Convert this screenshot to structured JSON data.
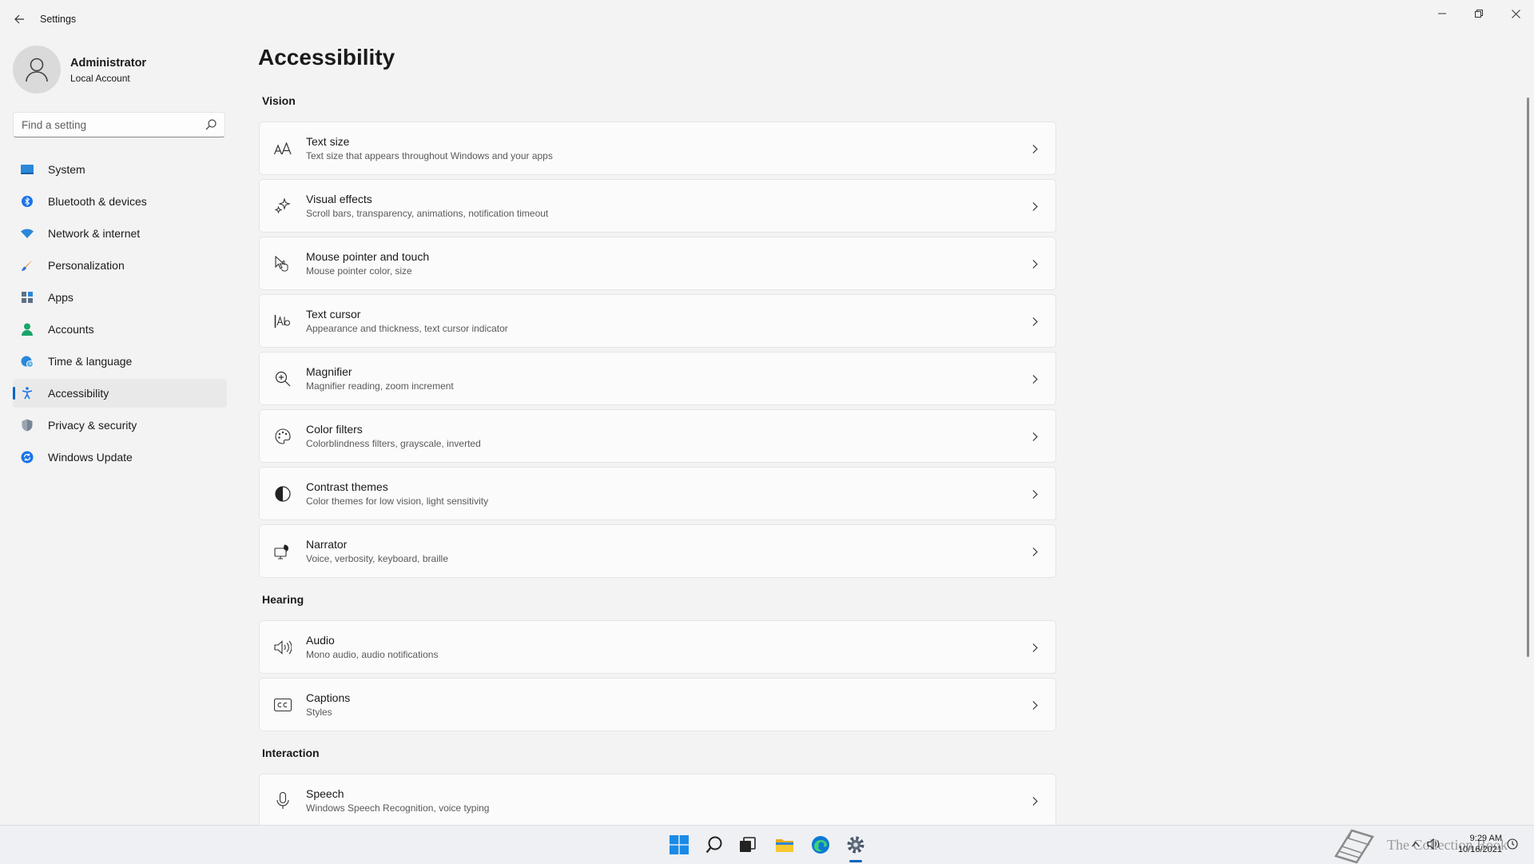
{
  "window": {
    "title": "Settings"
  },
  "profile": {
    "name": "Administrator",
    "account_type": "Local Account"
  },
  "search": {
    "placeholder": "Find a setting"
  },
  "sidebar": {
    "items": [
      {
        "label": "System",
        "icon": "system-icon"
      },
      {
        "label": "Bluetooth & devices",
        "icon": "bluetooth-icon"
      },
      {
        "label": "Network & internet",
        "icon": "wifi-icon"
      },
      {
        "label": "Personalization",
        "icon": "brush-icon"
      },
      {
        "label": "Apps",
        "icon": "apps-icon"
      },
      {
        "label": "Accounts",
        "icon": "person-icon"
      },
      {
        "label": "Time & language",
        "icon": "globe-clock-icon"
      },
      {
        "label": "Accessibility",
        "icon": "accessibility-icon",
        "selected": true
      },
      {
        "label": "Privacy & security",
        "icon": "shield-icon"
      },
      {
        "label": "Windows Update",
        "icon": "update-icon"
      }
    ]
  },
  "main": {
    "title": "Accessibility",
    "sections": [
      {
        "title": "Vision",
        "items": [
          {
            "title": "Text size",
            "subtitle": "Text size that appears throughout Windows and your apps",
            "icon": "text-size-icon"
          },
          {
            "title": "Visual effects",
            "subtitle": "Scroll bars, transparency, animations, notification timeout",
            "icon": "sparkle-icon"
          },
          {
            "title": "Mouse pointer and touch",
            "subtitle": "Mouse pointer color, size",
            "icon": "mouse-pointer-icon"
          },
          {
            "title": "Text cursor",
            "subtitle": "Appearance and thickness, text cursor indicator",
            "icon": "text-cursor-icon"
          },
          {
            "title": "Magnifier",
            "subtitle": "Magnifier reading, zoom increment",
            "icon": "magnifier-icon"
          },
          {
            "title": "Color filters",
            "subtitle": "Colorblindness filters, grayscale, inverted",
            "icon": "palette-icon"
          },
          {
            "title": "Contrast themes",
            "subtitle": "Color themes for low vision, light sensitivity",
            "icon": "contrast-icon"
          },
          {
            "title": "Narrator",
            "subtitle": "Voice, verbosity, keyboard, braille",
            "icon": "narrator-icon"
          }
        ]
      },
      {
        "title": "Hearing",
        "items": [
          {
            "title": "Audio",
            "subtitle": "Mono audio, audio notifications",
            "icon": "speaker-icon"
          },
          {
            "title": "Captions",
            "subtitle": "Styles",
            "icon": "captions-icon"
          }
        ]
      },
      {
        "title": "Interaction",
        "items": [
          {
            "title": "Speech",
            "subtitle": "Windows Speech Recognition, voice typing",
            "icon": "microphone-icon"
          }
        ]
      }
    ]
  },
  "taskbar": {
    "watermark": "The Collection Book",
    "time": "9:29 AM",
    "date": "10/16/2021"
  },
  "colors": {
    "accent": "#0067c0",
    "background": "#f3f3f3",
    "card": "#fbfbfb"
  }
}
